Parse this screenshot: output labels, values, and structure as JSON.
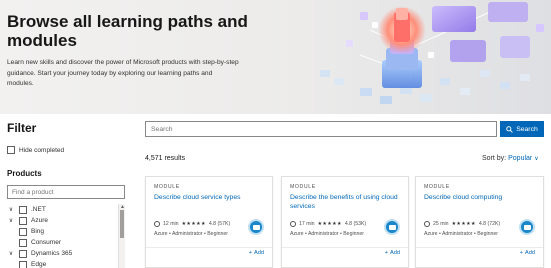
{
  "hero": {
    "title": "Browse all learning paths and modules",
    "description": "Learn new skills and discover the power of Microsoft products with step-by-step guidance. Start your journey today by exploring our learning paths and modules."
  },
  "filter": {
    "title": "Filter",
    "hide_completed": "Hide completed",
    "products_title": "Products",
    "find_placeholder": "Find a product",
    "products": [
      {
        "label": ".NET",
        "expandable": true
      },
      {
        "label": "Azure",
        "expandable": true
      },
      {
        "label": "Bing",
        "expandable": false
      },
      {
        "label": "Consumer",
        "expandable": false
      },
      {
        "label": "Dynamics 365",
        "expandable": true
      },
      {
        "label": "Edge",
        "expandable": false
      }
    ]
  },
  "search": {
    "placeholder": "Search",
    "button_label": "Search"
  },
  "results": {
    "count": "4,571 results",
    "sort_label": "Sort by:",
    "sort_value": "Popular"
  },
  "cards": [
    {
      "type": "MODULE",
      "title": "Describe cloud service types",
      "duration": "12 min",
      "stars": "★★★★★",
      "rating": "4.8 (57K)",
      "tags": "Azure • Administrator • Beginner",
      "add": "Add"
    },
    {
      "type": "MODULE",
      "title": "Describe the benefits of using cloud services",
      "duration": "17 min",
      "stars": "★★★★★",
      "rating": "4.8 (53K)",
      "tags": "Azure • Administrator • Beginner",
      "add": "Add"
    },
    {
      "type": "MODULE",
      "title": "Describe cloud computing",
      "duration": "25 min",
      "stars": "★★★★★",
      "rating": "4.8 (72K)",
      "tags": "Azure • Administrator • Beginner",
      "add": "Add"
    }
  ],
  "colors": {
    "accent": "#0067b8",
    "badge": "#1b86c9"
  }
}
